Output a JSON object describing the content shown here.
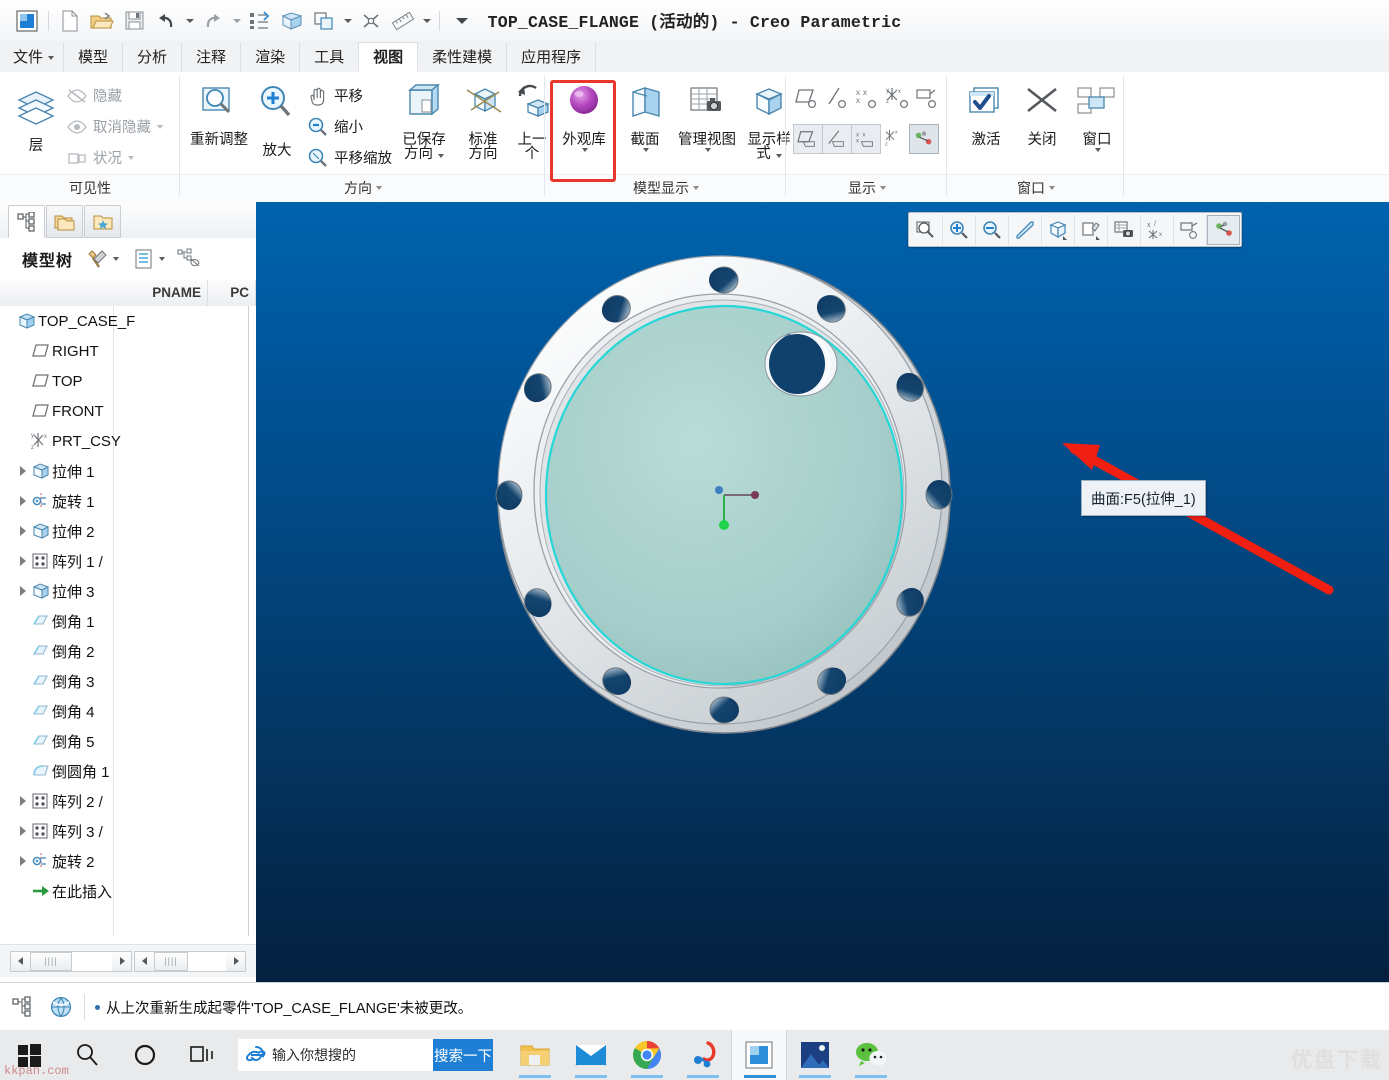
{
  "window": {
    "title": "TOP_CASE_FLANGE (活动的) - Creo Parametric"
  },
  "quick_access": {
    "items": [
      {
        "name": "app-logo-icon",
        "label": "Creo"
      },
      {
        "name": "new-file-icon",
        "label": "新建"
      },
      {
        "name": "open-file-icon",
        "label": "打开"
      },
      {
        "name": "save-icon",
        "label": "保存"
      },
      {
        "name": "undo-icon",
        "label": "撤消"
      },
      {
        "name": "redo-icon",
        "label": "重做"
      },
      {
        "name": "regenerate-icon",
        "label": "重新生成"
      },
      {
        "name": "shading-icon",
        "label": "着色"
      },
      {
        "name": "datum-display-icon",
        "label": "基准显示"
      },
      {
        "name": "close-window-icon",
        "label": "关闭窗口"
      },
      {
        "name": "measure-icon",
        "label": "测量"
      },
      {
        "name": "customize-qat-icon",
        "label": "自定义快速访问工具栏"
      }
    ]
  },
  "tabs": [
    {
      "label": "文件",
      "dropdown": true,
      "active": false
    },
    {
      "label": "模型",
      "active": false
    },
    {
      "label": "分析",
      "active": false
    },
    {
      "label": "注释",
      "active": false
    },
    {
      "label": "渲染",
      "active": false
    },
    {
      "label": "工具",
      "active": false
    },
    {
      "label": "视图",
      "active": true
    },
    {
      "label": "柔性建模",
      "active": false
    },
    {
      "label": "应用程序",
      "active": false
    }
  ],
  "ribbon": {
    "groups": [
      {
        "name": "visibility",
        "label": "可见性",
        "has_dropdown": false,
        "big_buttons": [
          {
            "label": "层",
            "icon": "layers-icon"
          }
        ],
        "small_buttons": [
          {
            "label": "隐藏",
            "icon": "hide-icon",
            "disabled": true,
            "dropdown": false
          },
          {
            "label": "取消隐藏",
            "icon": "unhide-icon",
            "disabled": true,
            "dropdown": true
          },
          {
            "label": "状况",
            "icon": "status-icon",
            "disabled": true,
            "dropdown": true
          }
        ]
      },
      {
        "name": "orientation",
        "label": "方向",
        "has_dropdown": true,
        "big_buttons": [
          {
            "label": "重新调整",
            "icon": "refit-icon"
          },
          {
            "label": "放大",
            "icon": "zoom-in-icon"
          },
          {
            "label": "已保存方向",
            "icon": "saved-orientation-icon",
            "dropdown": true
          },
          {
            "label": "标准方向",
            "icon": "standard-orientation-icon"
          },
          {
            "label": "上一个",
            "icon": "previous-view-icon"
          }
        ],
        "small_buttons": [
          {
            "label": "平移",
            "icon": "pan-icon",
            "dropdown": false
          },
          {
            "label": "缩小",
            "icon": "zoom-out-icon",
            "dropdown": false
          },
          {
            "label": "平移缩放",
            "icon": "pan-zoom-icon",
            "dropdown": false
          }
        ]
      },
      {
        "name": "model-display",
        "label": "模型显示",
        "has_dropdown": true,
        "highlighted_button": "外观库",
        "big_buttons": [
          {
            "label": "外观库",
            "icon": "appearance-gallery-icon",
            "dropdown": true,
            "highlighted": true
          },
          {
            "label": "截面",
            "icon": "section-icon",
            "dropdown": true
          },
          {
            "label": "管理视图",
            "icon": "manage-views-icon",
            "dropdown": true
          },
          {
            "label": "显示样式",
            "icon": "display-style-icon",
            "dropdown": true
          }
        ],
        "small_buttons": []
      },
      {
        "name": "display",
        "label": "显示",
        "has_dropdown": true,
        "big_buttons": [],
        "small_buttons": [
          {
            "label": "",
            "icon": "plane-display-icon"
          },
          {
            "label": "",
            "icon": "axis-display-icon"
          },
          {
            "label": "",
            "icon": "point-display-icon"
          },
          {
            "label": "",
            "icon": "csys-display-icon"
          },
          {
            "label": "",
            "icon": "annotation-display-icon"
          },
          {
            "label": "",
            "icon": "plane-tag-icon"
          },
          {
            "label": "",
            "icon": "axis-tag-icon"
          },
          {
            "label": "",
            "icon": "point-tag-icon"
          },
          {
            "label": "",
            "icon": "csys-tag-icon"
          },
          {
            "label": "",
            "icon": "spin-center-icon"
          }
        ]
      },
      {
        "name": "window",
        "label": "窗口",
        "has_dropdown": true,
        "big_buttons": [
          {
            "label": "激活",
            "icon": "activate-icon"
          },
          {
            "label": "关闭",
            "icon": "close-x-icon"
          },
          {
            "label": "窗口",
            "icon": "window-icon",
            "dropdown": true
          }
        ],
        "small_buttons": []
      }
    ]
  },
  "left_panel": {
    "nav_tabs": [
      {
        "name": "model-tree-tab",
        "icon": "tree-icon",
        "selected": true
      },
      {
        "name": "folder-browser-tab",
        "icon": "folders-icon",
        "selected": false
      },
      {
        "name": "favorites-tab",
        "icon": "favorites-folder-icon",
        "selected": false
      }
    ],
    "header": {
      "title": "模型树",
      "tools": [
        {
          "name": "settings-tools-icon",
          "dropdown": true
        },
        {
          "name": "display-list-icon",
          "dropdown": true
        },
        {
          "name": "tree-filters-icon",
          "dropdown": false
        }
      ]
    },
    "columns": [
      "PNAME",
      "PC"
    ],
    "tree_items": [
      {
        "label": "TOP_CASE_F",
        "icon": "part-icon",
        "indent": 0,
        "expandable": false
      },
      {
        "label": "RIGHT",
        "icon": "datum-plane-icon",
        "indent": 1,
        "expandable": false
      },
      {
        "label": "TOP",
        "icon": "datum-plane-icon",
        "indent": 1,
        "expandable": false
      },
      {
        "label": "FRONT",
        "icon": "datum-plane-icon",
        "indent": 1,
        "expandable": false
      },
      {
        "label": "PRT_CSY",
        "icon": "csys-icon",
        "indent": 1,
        "expandable": false
      },
      {
        "label": "拉伸 1",
        "icon": "extrude-icon",
        "indent": 1,
        "expandable": true
      },
      {
        "label": "旋转 1",
        "icon": "revolve-icon",
        "indent": 1,
        "expandable": true
      },
      {
        "label": "拉伸 2",
        "icon": "extrude-icon",
        "indent": 1,
        "expandable": true
      },
      {
        "label": "阵列 1 /",
        "icon": "pattern-icon",
        "indent": 1,
        "expandable": true
      },
      {
        "label": "拉伸 3",
        "icon": "extrude-icon",
        "indent": 1,
        "expandable": true
      },
      {
        "label": "倒角 1",
        "icon": "chamfer-icon",
        "indent": 1,
        "expandable": false
      },
      {
        "label": "倒角 2",
        "icon": "chamfer-icon",
        "indent": 1,
        "expandable": false
      },
      {
        "label": "倒角 3",
        "icon": "chamfer-icon",
        "indent": 1,
        "expandable": false
      },
      {
        "label": "倒角 4",
        "icon": "chamfer-icon",
        "indent": 1,
        "expandable": false
      },
      {
        "label": "倒角 5",
        "icon": "chamfer-icon",
        "indent": 1,
        "expandable": false
      },
      {
        "label": "倒圆角 1",
        "icon": "round-icon",
        "indent": 1,
        "expandable": false
      },
      {
        "label": "阵列 2 /",
        "icon": "pattern-icon",
        "indent": 1,
        "expandable": true
      },
      {
        "label": "阵列 3 /",
        "icon": "pattern-icon",
        "indent": 1,
        "expandable": true
      },
      {
        "label": "旋转 2",
        "icon": "revolve-icon",
        "indent": 1,
        "expandable": true
      },
      {
        "label": "在此插入",
        "icon": "insert-here-icon",
        "indent": 1,
        "expandable": false
      }
    ]
  },
  "graphics": {
    "toolbar": [
      {
        "name": "refit-icon",
        "active": false
      },
      {
        "name": "zoom-in-icon",
        "active": false
      },
      {
        "name": "zoom-out-icon",
        "active": false
      },
      {
        "name": "repaint-icon",
        "active": false
      },
      {
        "name": "display-style-icon",
        "active": false
      },
      {
        "name": "appearance-icon",
        "active": false
      },
      {
        "name": "saved-view-icon",
        "active": false
      },
      {
        "name": "datum-display-icon",
        "active": false
      },
      {
        "name": "annotation-display-icon",
        "active": false
      },
      {
        "name": "spin-center-icon",
        "active": true
      }
    ],
    "tooltip": "曲面:F5(拉伸_1)",
    "background_top": "#0063ad",
    "background_bottom": "#04203f",
    "model": {
      "name": "flange",
      "bolt_hole_count": 12,
      "face_color": "#a7cfcc",
      "body_color": "#d6dadd",
      "highlight_edge_color": "#25d7d7",
      "arrow_color": "#f01f12"
    }
  },
  "status_bar": {
    "icons": [
      {
        "name": "model-tree-toggle-icon"
      },
      {
        "name": "browser-toggle-icon"
      }
    ],
    "message": "从上次重新生成起零件'TOP_CASE_FLANGE'未被更改。"
  },
  "taskbar": {
    "start": {
      "name": "windows-start-icon"
    },
    "search": {
      "name": "search-icon"
    },
    "cortana": {
      "name": "cortana-icon"
    },
    "taskview": {
      "name": "task-view-icon"
    },
    "ie_search": {
      "icon": "internet-explorer-icon",
      "placeholder": "输入你想搜的",
      "button_label": "搜索一下"
    },
    "apps": [
      {
        "name": "file-explorer-icon",
        "active": false
      },
      {
        "name": "mail-icon",
        "active": false
      },
      {
        "name": "chrome-icon",
        "active": false
      },
      {
        "name": "qq-icon",
        "active": false
      },
      {
        "name": "creo-icon",
        "active": true
      },
      {
        "name": "photos-icon",
        "active": false
      },
      {
        "name": "wechat-icon",
        "active": false
      }
    ]
  },
  "watermarks": {
    "bottom_left": "kkpan.com",
    "bottom_right": "优盘下载"
  }
}
